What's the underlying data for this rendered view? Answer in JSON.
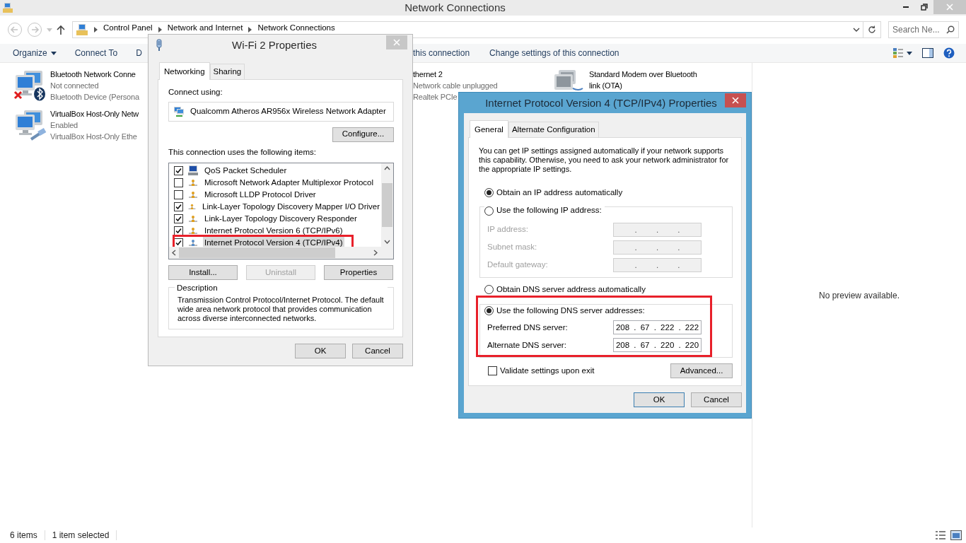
{
  "window": {
    "title": "Network Connections"
  },
  "address_bar": {
    "breadcrumbs": [
      "Control Panel",
      "Network and Internet",
      "Network Connections"
    ],
    "search_placeholder": "Search Ne..."
  },
  "command_bar": [
    {
      "label": "Organize",
      "kind": "menu"
    },
    {
      "label": "Connect To",
      "kind": "button"
    },
    {
      "label": "D",
      "kind": "button"
    },
    {
      "label": "this connection",
      "kind": "button"
    },
    {
      "label": "Change settings of this connection",
      "kind": "button"
    }
  ],
  "connections": [
    {
      "name": "Bluetooth Network Conne",
      "status": "Not connected",
      "device": "Bluetooth Device (Persona",
      "kind": "bluetooth"
    },
    {
      "name": "thernet 2",
      "status": "Network cable unplugged",
      "device": "Realtek PCIe",
      "kind": "hidden"
    },
    {
      "name": "Standard Modem over Bluetooth link (OTA)",
      "kind": "modem"
    },
    {
      "name": "VirtualBox Host-Only Netw",
      "status": "Enabled",
      "device": "VirtualBox Host-Only Ethe",
      "kind": "virtualbox"
    }
  ],
  "preview": {
    "text": "No preview available."
  },
  "status_bar": {
    "items": "6 items",
    "selection": "1 item selected"
  },
  "wifi_dialog": {
    "title": "Wi-Fi 2 Properties",
    "tabs": [
      {
        "label": "Networking",
        "selected": true
      },
      {
        "label": "Sharing",
        "selected": false
      }
    ],
    "connect_using": "Connect using:",
    "adapter": "Qualcomm Atheros AR956x Wireless Network Adapter",
    "configure_button": "Configure...",
    "items_label": "This connection uses the following items:",
    "items": [
      {
        "label": "QoS Packet Scheduler",
        "kind": "service",
        "checked": true,
        "selected": false,
        "highlighted": false
      },
      {
        "label": "Microsoft Network Adapter Multiplexor Protocol",
        "kind": "protocol",
        "checked": false,
        "selected": false,
        "highlighted": false
      },
      {
        "label": "Microsoft LLDP Protocol Driver",
        "kind": "protocol",
        "checked": false,
        "selected": false,
        "highlighted": false
      },
      {
        "label": "Link-Layer Topology Discovery Mapper I/O Driver",
        "kind": "protocol",
        "checked": true,
        "selected": false,
        "highlighted": false
      },
      {
        "label": "Link-Layer Topology Discovery Responder",
        "kind": "protocol",
        "checked": true,
        "selected": false,
        "highlighted": false
      },
      {
        "label": "Internet Protocol Version 6 (TCP/IPv6)",
        "kind": "protocol",
        "checked": true,
        "selected": false,
        "highlighted": false
      },
      {
        "label": "Internet Protocol Version 4 (TCP/IPv4)",
        "kind": "protocol",
        "checked": true,
        "selected": true,
        "highlighted": true
      }
    ],
    "action_buttons": [
      {
        "label": "Install...",
        "disabled": false
      },
      {
        "label": "Uninstall",
        "disabled": true
      },
      {
        "label": "Properties",
        "disabled": false
      }
    ],
    "description_label": "Description",
    "description": "Transmission Control Protocol/Internet Protocol. The default wide area network protocol that provides communication across diverse interconnected networks.",
    "buttons": [
      {
        "label": "OK",
        "default": false
      },
      {
        "label": "Cancel",
        "default": false
      }
    ]
  },
  "ipv4_dialog": {
    "title": "Internet Protocol Version 4 (TCP/IPv4) Properties",
    "tabs": [
      {
        "label": "General",
        "selected": true
      },
      {
        "label": "Alternate Configuration",
        "selected": false
      }
    ],
    "intro": "You can get IP settings assigned automatically if your network supports this capability. Otherwise, you need to ask your network administrator for the appropriate IP settings.",
    "ip_options": [
      {
        "label": "Obtain an IP address automatically",
        "selected": true
      },
      {
        "label": "Use the following IP address:",
        "selected": false
      }
    ],
    "ip_fields": [
      {
        "label": "IP address:",
        "value": ". . .",
        "disabled": true
      },
      {
        "label": "Subnet mask:",
        "value": ". . .",
        "disabled": true
      },
      {
        "label": "Default gateway:",
        "value": ". . .",
        "disabled": true
      }
    ],
    "dns_options": [
      {
        "label": "Obtain DNS server address automatically",
        "selected": false
      },
      {
        "label": "Use the following DNS server addresses:",
        "selected": true
      }
    ],
    "dns_fields": [
      {
        "label": "Preferred DNS server:",
        "value": "208 . 67 . 222 . 222",
        "disabled": false
      },
      {
        "label": "Alternate DNS server:",
        "value": "208 . 67 . 220 . 220",
        "disabled": false
      }
    ],
    "dns_highlighted": true,
    "validate": {
      "label": "Validate settings upon exit",
      "checked": false
    },
    "advanced_button": "Advanced...",
    "buttons": [
      {
        "label": "OK",
        "default": true
      },
      {
        "label": "Cancel",
        "default": false
      }
    ]
  }
}
